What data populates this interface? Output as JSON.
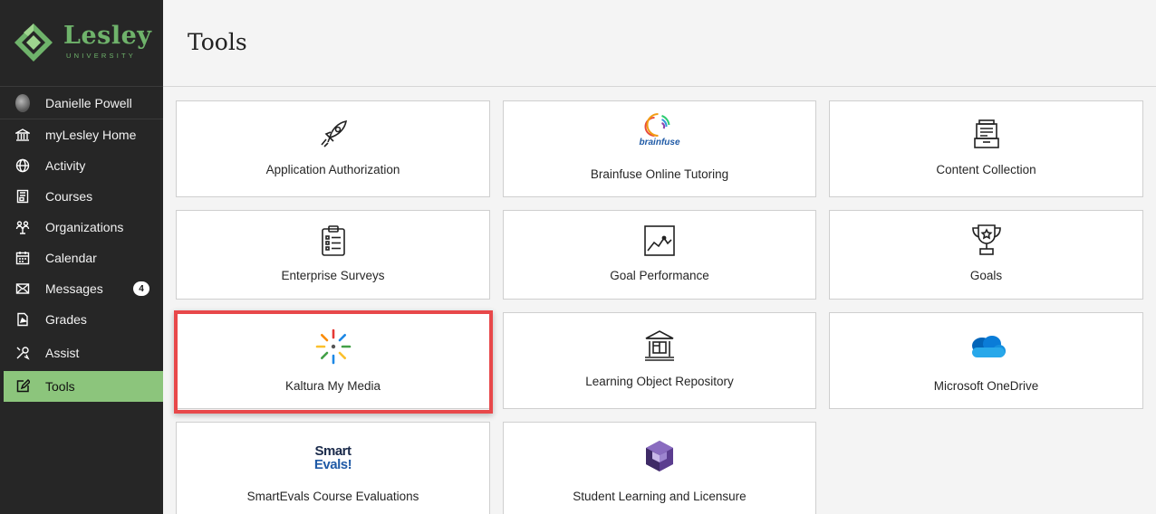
{
  "brand": {
    "name": "Lesley",
    "sub": "UNIVERSITY",
    "accent": "#6fb36b"
  },
  "sidebar": {
    "items": [
      {
        "label": "Danielle Powell",
        "icon": "avatar"
      },
      {
        "label": "myLesley Home",
        "icon": "institution-icon"
      },
      {
        "label": "Activity",
        "icon": "globe-icon"
      },
      {
        "label": "Courses",
        "icon": "book-icon"
      },
      {
        "label": "Organizations",
        "icon": "people-icon"
      },
      {
        "label": "Calendar",
        "icon": "calendar-icon"
      },
      {
        "label": "Messages",
        "icon": "mail-icon",
        "badge": "4"
      },
      {
        "label": "Grades",
        "icon": "grades-icon"
      },
      {
        "label": "Assist",
        "icon": "tools-assist-icon"
      },
      {
        "label": "Tools",
        "icon": "edit-icon",
        "active": true
      }
    ],
    "active_color": "#8cc57c"
  },
  "header": {
    "title": "Tools"
  },
  "tools": [
    {
      "label": "Application Authorization",
      "icon": "rocket-icon"
    },
    {
      "label": "Brainfuse Online Tutoring",
      "icon": "brainfuse-logo"
    },
    {
      "label": "Content Collection",
      "icon": "content-collection-icon"
    },
    {
      "label": "Enterprise Surveys",
      "icon": "clipboard-icon"
    },
    {
      "label": "Goal Performance",
      "icon": "chart-icon"
    },
    {
      "label": "Goals",
      "icon": "trophy-icon"
    },
    {
      "label": "Kaltura My Media",
      "icon": "kaltura-logo",
      "highlighted": true
    },
    {
      "label": "Learning Object Repository",
      "icon": "repository-icon"
    },
    {
      "label": "Microsoft OneDrive",
      "icon": "onedrive-icon"
    },
    {
      "label": "SmartEvals Course Evaluations",
      "icon": "smartevals-logo"
    },
    {
      "label": "Student Learning and Licensure",
      "icon": "cube-logo"
    }
  ],
  "logo_text": {
    "brainfuse": "brainfuse",
    "smartevals_1": "Smart",
    "smartevals_2": "Evals!"
  },
  "highlight_color": "#e8484a"
}
